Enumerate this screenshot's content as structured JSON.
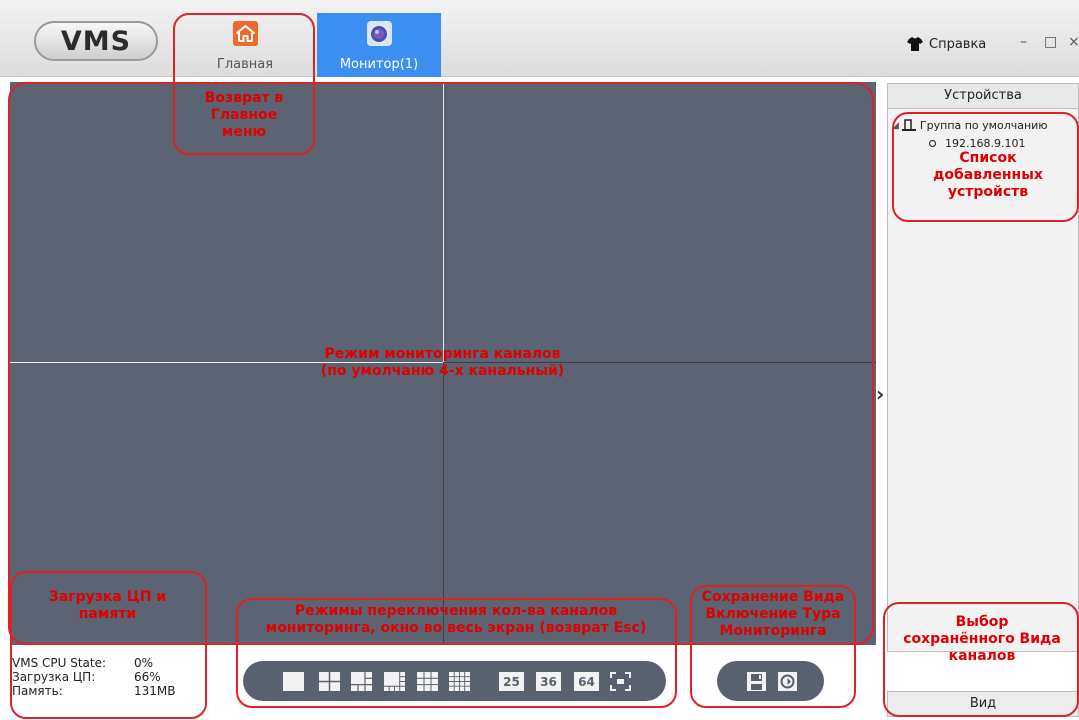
{
  "app": {
    "logo": "VMS",
    "tabs": [
      {
        "label": "Главная",
        "icon": "home-icon"
      },
      {
        "label": "Монитор(1)",
        "icon": "camera-icon"
      }
    ],
    "help_label": "Справка",
    "window_controls": {
      "minimize": "–",
      "maximize": "□",
      "close": "×"
    }
  },
  "right_panel": {
    "header": "Устройства",
    "tree": {
      "group": "Группа по умолчанию",
      "device": "192.168.9.101"
    },
    "footer": "Вид"
  },
  "stats": [
    {
      "label": "VMS CPU State:",
      "value": "0%"
    },
    {
      "label": "Загрузка ЦП:",
      "value": "66%"
    },
    {
      "label": "Память:",
      "value": "131MB"
    }
  ],
  "layout_buttons": {
    "num25": "25",
    "num36": "36",
    "num64": "64"
  },
  "annotations": {
    "home": "Возврат в\nГлавное\nменю",
    "devices": "Список\nдобавленных\nустройств",
    "channels": "Режим мониторинга каналов\n(по умолчаню 4-х канальный)",
    "cpu": "Загрузка ЦП и\nпамяти",
    "layouts": "Режимы переключения кол-ва каналов\nмониторинга, окно во весь экран (возврат Esc)",
    "save_view": "Сохранение Вида\nВключение Тура\nМониторинга",
    "saved_view": "Выбор\nсохранённого Вида\nканалов"
  },
  "colors": {
    "accent_tab": "#3b8ff0",
    "home_icon": "#f0692c",
    "video_bg": "#5c6373",
    "toolbar_bg": "#59616f",
    "annotation": "#e00000"
  }
}
